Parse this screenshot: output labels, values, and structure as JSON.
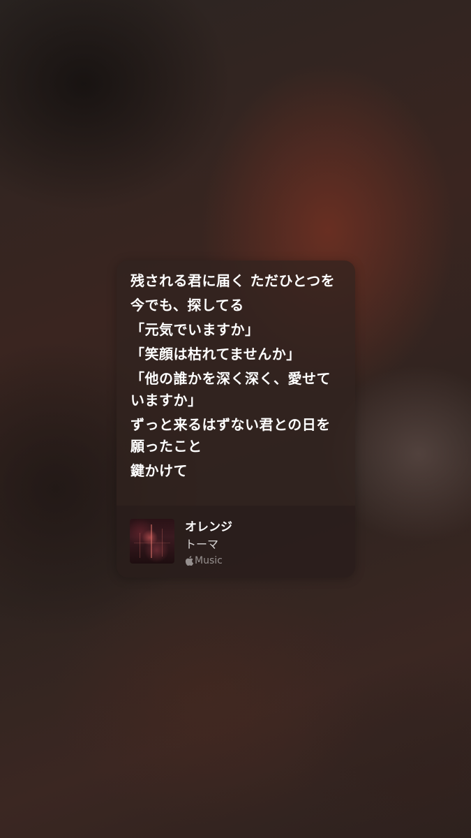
{
  "lyrics": {
    "lines": [
      "残される君に届く ただひとつを",
      "今でも、探してる",
      "「元気でいますか」",
      "「笑顔は枯れてませんか」",
      "「他の誰かを深く深く、愛せていますか」",
      "ずっと来るはずない君との日を願ったこと",
      "鍵かけて"
    ]
  },
  "track": {
    "title": "オレンジ",
    "artist": "トーマ",
    "service_label": "Music",
    "service_icon": "apple-logo-icon",
    "artwork": "album-artwork"
  }
}
